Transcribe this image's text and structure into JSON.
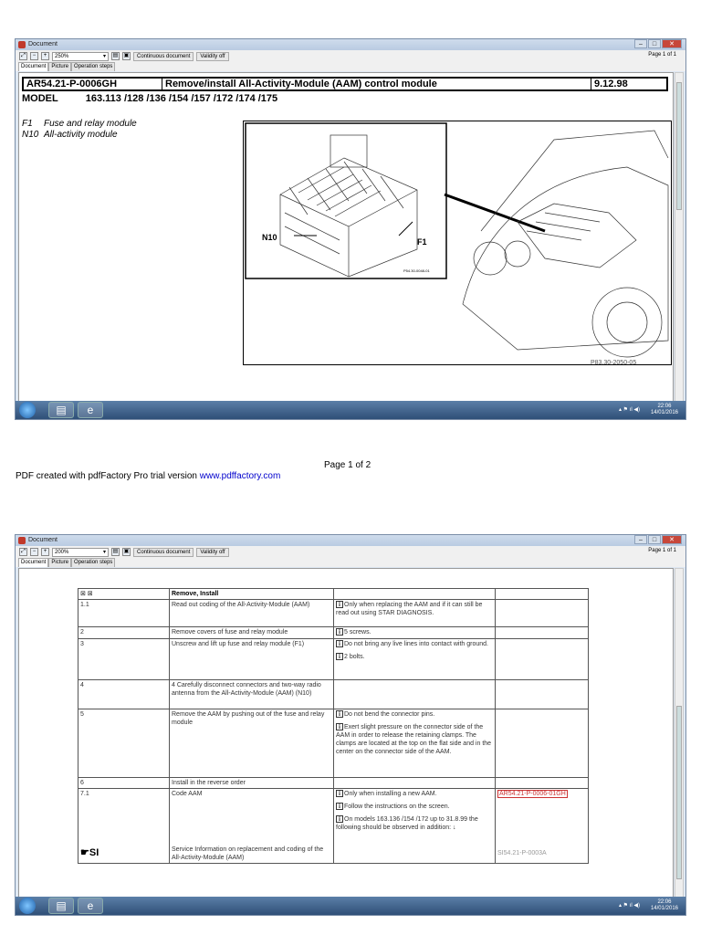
{
  "windows": [
    {
      "title": "Document",
      "zoom": "250%",
      "view_mode": "Continuous document",
      "validity": "Validity off",
      "page": "Page 1 of 1",
      "tabs": [
        "Document",
        "Picture",
        "Operation steps"
      ]
    },
    {
      "title": "Document",
      "zoom": "200%",
      "view_mode": "Continuous document",
      "validity": "Validity off",
      "page": "Page 1 of 1",
      "tabs": [
        "Document",
        "Picture",
        "Operation steps"
      ]
    }
  ],
  "doc": {
    "id": "AR54.21-P-0006GH",
    "title": "Remove/install All-Activity-Module (AAM) control module",
    "date": "9.12.98",
    "model_label": "MODEL",
    "models": "163.113 /128 /136 /154 /157 /172 /174 /175",
    "legend": [
      {
        "code": "F1",
        "text": "Fuse and relay module"
      },
      {
        "code": "N10",
        "text": "All-activity module"
      }
    ],
    "figure": {
      "label_n10": "N10",
      "label_f1": "F1",
      "inset_ref": "P54.30-0048-01",
      "ref": "P83.30-2050-05"
    }
  },
  "taskbar": {
    "time": "22:06",
    "date": "14/01/2016"
  },
  "footer": {
    "text": "PDF created with pdfFactory Pro trial version ",
    "link": "www.pdffactory.com",
    "page": "Page 1 of 2"
  },
  "steps_table": {
    "header": "Remove, Install",
    "rows": [
      {
        "n": "1.1",
        "action": "Read out coding of the All-Activity-Module (AAM)",
        "notes": [
          "Only when   replacing the AAM and if it can still be read out using STAR DIAGNOSIS."
        ],
        "ref": ""
      },
      {
        "n": "2",
        "action": "Remove covers of fuse and relay module",
        "notes": [
          "5 screws."
        ],
        "ref": ""
      },
      {
        "n": "3",
        "action": "Unscrew and lift up fuse and relay module (F1)",
        "notes": [
          "Do not bring any live lines into contact with ground.",
          "2 bolts."
        ],
        "ref": ""
      },
      {
        "n": "4",
        "action": "4 Carefully disconnect connectors and two-way radio antenna from the All-Activity-Module (AAM) (N10)",
        "notes": [],
        "ref": ""
      },
      {
        "n": "5",
        "action": "Remove the AAM by pushing out of the fuse and relay module",
        "notes": [
          "Do not bend the connector pins.",
          "Exert slight pressure on the connector side of the AAM  in order to release the retaining clamps. The clamps are located at the top on the flat side and in the center on the connector side of the AAM."
        ],
        "ref": ""
      },
      {
        "n": "6",
        "action": "Install in the reverse order",
        "notes": [],
        "ref": ""
      },
      {
        "n": "7.1",
        "action": "Code AAM",
        "notes": [
          "Only when installing a new AAM.",
          "Follow the instructions on the screen.",
          "On models 163.136 /154 /172 up to 31.8.99 the following should be observed in addition: ↓"
        ],
        "ref": "AR54.21-P-0006-01GH"
      }
    ],
    "si": {
      "label": "SI",
      "action": "Service Information on replacement and coding of the All-Activity-Module (AAM)",
      "ref": "SI54.21-P-0003A"
    }
  }
}
